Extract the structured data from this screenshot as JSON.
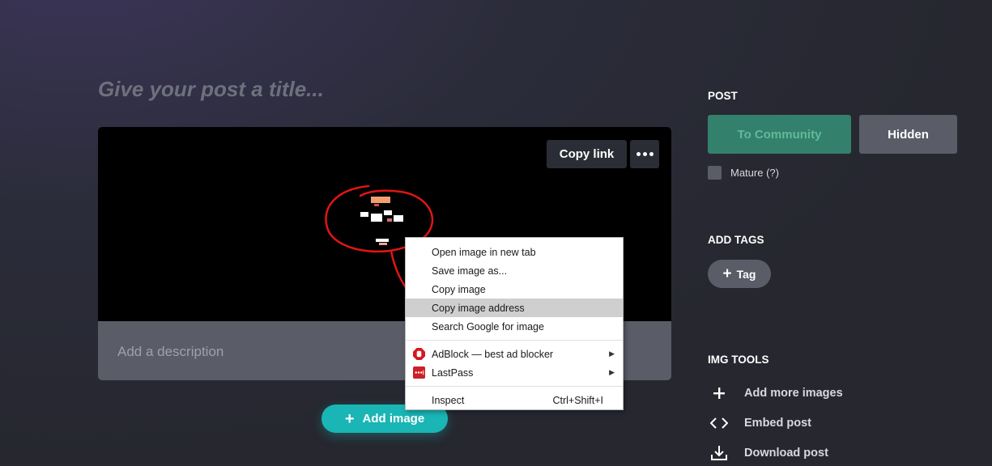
{
  "post": {
    "title_placeholder": "Give your post a title...",
    "description_placeholder": "Add a description",
    "copy_link_label": "Copy link",
    "add_image_label": "Add image"
  },
  "context_menu": {
    "items": [
      {
        "label": "Open image in new tab"
      },
      {
        "label": "Save image as..."
      },
      {
        "label": "Copy image"
      },
      {
        "label": "Copy image address",
        "highlighted": true
      },
      {
        "label": "Search Google for image"
      },
      {
        "label": "AdBlock — best ad blocker",
        "icon": "adblock-icon",
        "submenu": true
      },
      {
        "label": "LastPass",
        "icon": "lastpass-icon",
        "submenu": true
      },
      {
        "label": "Inspect",
        "shortcut": "Ctrl+Shift+I"
      }
    ]
  },
  "sidebar": {
    "post_section_title": "POST",
    "to_community_label": "To Community",
    "hidden_label": "Hidden",
    "mature_label": "Mature (?)",
    "tags_section_title": "ADD TAGS",
    "tag_button_label": "Tag",
    "tools_section_title": "IMG TOOLS",
    "tools": [
      {
        "label": "Add more images",
        "icon": "plus-icon"
      },
      {
        "label": "Embed post",
        "icon": "code-icon"
      },
      {
        "label": "Download post",
        "icon": "download-icon"
      }
    ]
  },
  "colors": {
    "accent_teal": "#1ab5b5",
    "community_green": "#33816c",
    "annotation_red": "#e01515"
  }
}
